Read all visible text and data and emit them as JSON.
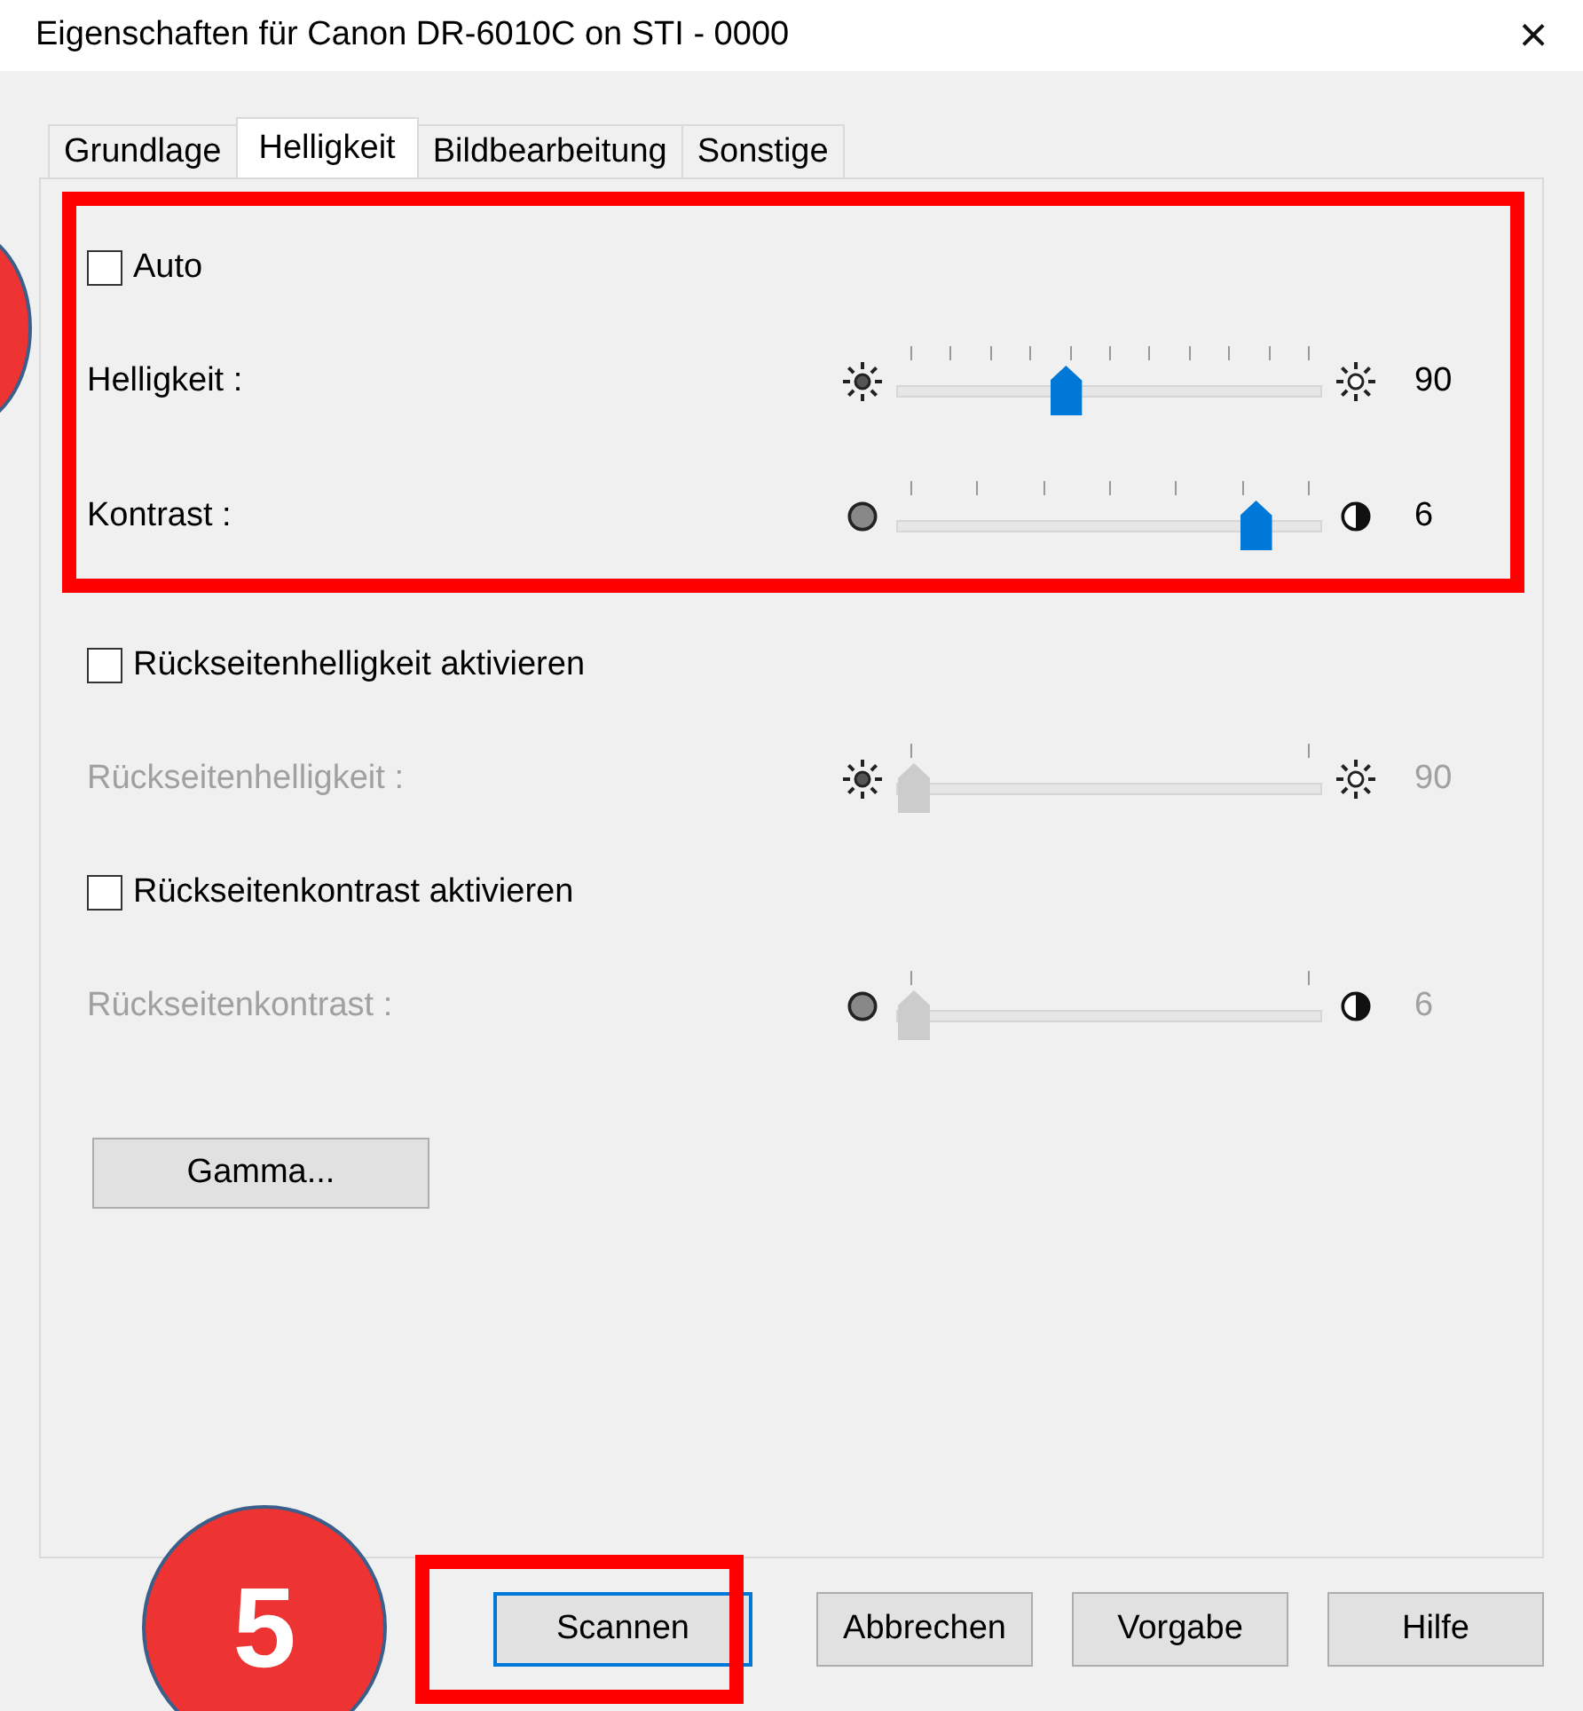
{
  "window": {
    "title": "Eigenschaften für Canon DR-6010C on STI - 0000",
    "close": "×"
  },
  "tabs": [
    {
      "label": "Grundlage",
      "selected": false
    },
    {
      "label": "Helligkeit",
      "selected": true
    },
    {
      "label": "Bildbearbeitung",
      "selected": false
    },
    {
      "label": "Sonstige",
      "selected": false
    }
  ],
  "groups": [
    {
      "controls": [
        {
          "kind": "checkbox",
          "label": "Auto",
          "checked": false
        },
        {
          "kind": "brightness",
          "label": "Helligkeit :",
          "level": 0.36,
          "value": "90",
          "disabled": false
        },
        {
          "kind": "contrast",
          "label": "Kontrast :",
          "level": 0.81,
          "value": "6",
          "disabled": false
        }
      ]
    },
    {
      "controls": [
        {
          "kind": "checkbox",
          "label": "Rückseitenhelligkeit aktivieren",
          "checked": false
        },
        {
          "kind": "brightness",
          "label": "Rückseitenhelligkeit :",
          "level": 0,
          "value": "90",
          "disabled": true
        },
        {
          "kind": "checkbox",
          "label": "Rückseitenkontrast aktivieren",
          "checked": false
        },
        {
          "kind": "contrast",
          "label": "Rückseitenkontrast :",
          "level": 0,
          "value": "6",
          "disabled": true
        }
      ]
    }
  ],
  "gamma_button": "Gamma...",
  "buttons": [
    {
      "label": "Scannen",
      "default": true
    },
    {
      "label": "Abbrechen",
      "default": false
    },
    {
      "label": "Vorgabe",
      "default": false
    },
    {
      "label": "Hilfe",
      "default": false
    }
  ],
  "markers": [
    {
      "kind": "circle"
    },
    {
      "kind": "box"
    },
    {
      "kind": "circle",
      "label": "5"
    },
    {
      "kind": "box"
    }
  ]
}
